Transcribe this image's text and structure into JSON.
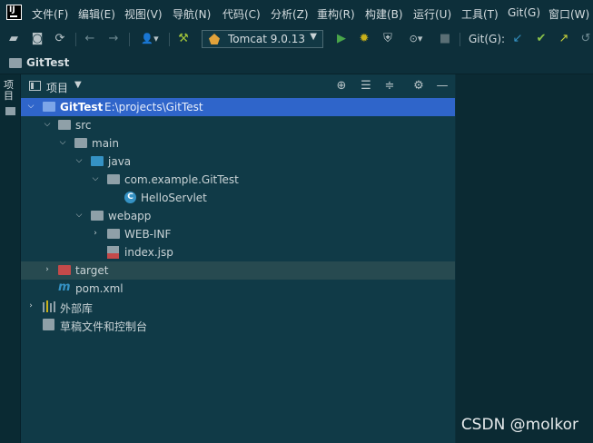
{
  "menu": [
    "文件(F)",
    "编辑(E)",
    "视图(V)",
    "导航(N)",
    "代码(C)",
    "分析(Z)",
    "重构(R)",
    "构建(B)",
    "运行(U)",
    "工具(T)",
    "Git(G)",
    "窗口(W)"
  ],
  "toolbar": {
    "run_config": "Tomcat 9.0.13",
    "git_label": "Git(G):"
  },
  "breadcrumb": "GitTest",
  "side_tab": "项目",
  "panel": {
    "title": "项目"
  },
  "tree": {
    "root": {
      "name": "GitTest",
      "path": "E:\\projects\\GitTest"
    },
    "src": "src",
    "main": "main",
    "java": "java",
    "package": "com.example.GitTest",
    "class": "HelloServlet",
    "webapp": "webapp",
    "webinf": "WEB-INF",
    "index": "index.jsp",
    "target": "target",
    "pom": "pom.xml",
    "ext_libs": "外部库",
    "scratches": "草稿文件和控制台"
  },
  "watermark": "CSDN @molkor",
  "colors": {
    "selection": "#2f65ca",
    "folder_blue": "#3592c4",
    "folder_red": "#c44a4a",
    "run_green": "#49a64a",
    "debug_yellow": "#c9b11a"
  }
}
